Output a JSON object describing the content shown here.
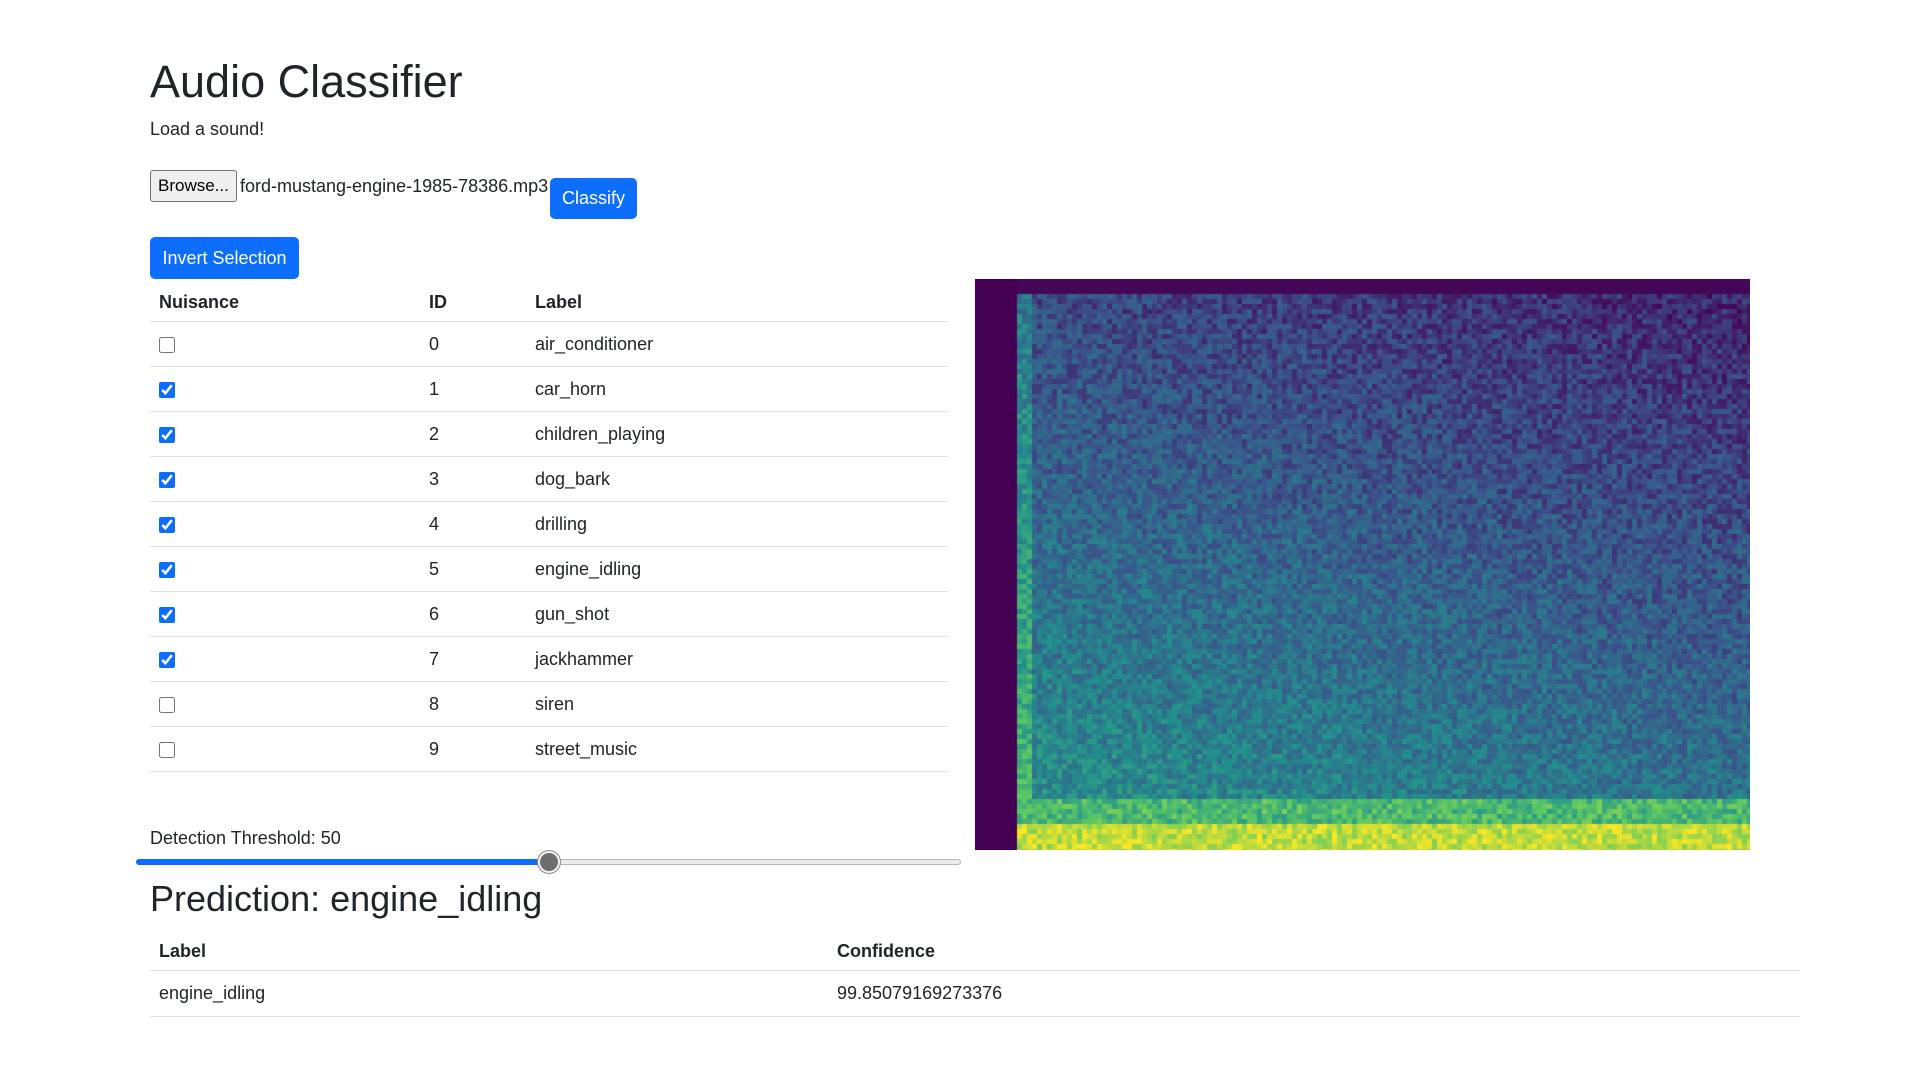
{
  "header": {
    "title": "Audio Classifier",
    "subtitle": "Load a sound!"
  },
  "file_input": {
    "browse_label": "Browse...",
    "file_name": "ford-mustang-engine-1985-78386.mp3"
  },
  "actions": {
    "classify_label": "Classify",
    "invert_label": "Invert Selection"
  },
  "nuisance_table": {
    "headers": [
      "Nuisance",
      "ID",
      "Label"
    ],
    "rows": [
      {
        "checked": false,
        "id": "0",
        "label": "air_conditioner"
      },
      {
        "checked": true,
        "id": "1",
        "label": "car_horn"
      },
      {
        "checked": true,
        "id": "2",
        "label": "children_playing"
      },
      {
        "checked": true,
        "id": "3",
        "label": "dog_bark"
      },
      {
        "checked": true,
        "id": "4",
        "label": "drilling"
      },
      {
        "checked": true,
        "id": "5",
        "label": "engine_idling"
      },
      {
        "checked": true,
        "id": "6",
        "label": "gun_shot"
      },
      {
        "checked": true,
        "id": "7",
        "label": "jackhammer"
      },
      {
        "checked": false,
        "id": "8",
        "label": "siren"
      },
      {
        "checked": false,
        "id": "9",
        "label": "street_music"
      }
    ]
  },
  "threshold": {
    "label": "Detection Threshold: 50",
    "value": 50,
    "min": 0,
    "max": 100
  },
  "prediction": {
    "title": "Prediction: engine_idling",
    "headers": [
      "Label",
      "Confidence"
    ],
    "rows": [
      {
        "label": "engine_idling",
        "confidence": "99.85079169273376"
      }
    ]
  },
  "colors": {
    "accent": "#0d6efd",
    "spectrogram_background": "#440154"
  }
}
